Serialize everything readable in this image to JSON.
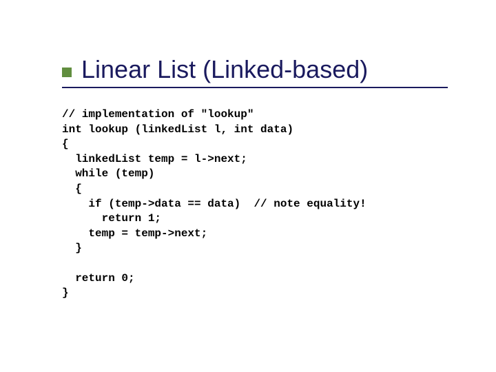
{
  "slide": {
    "title": "Linear List (Linked-based)",
    "code": "// implementation of \"lookup\"\nint lookup (linkedList l, int data)\n{\n  linkedList temp = l->next;\n  while (temp)\n  {\n    if (temp->data == data)  // note equality!\n      return 1;\n    temp = temp->next;\n  }\n\n  return 0;\n}"
  }
}
